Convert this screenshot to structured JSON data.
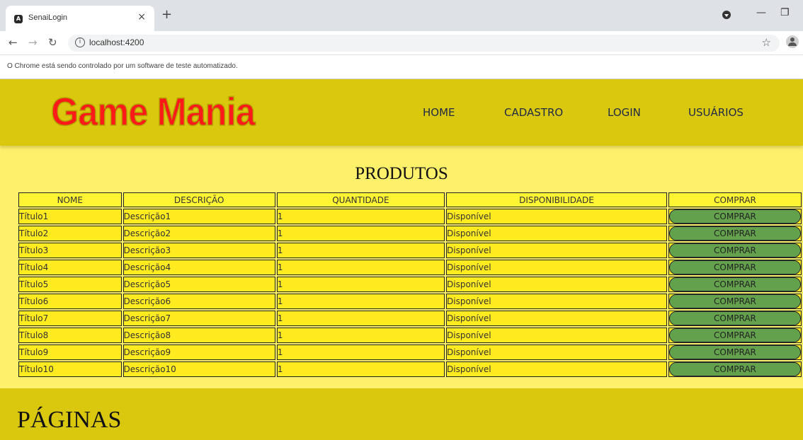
{
  "browser": {
    "tab_title": "SenaiLogin",
    "tab_favicon": "A",
    "tab_close": "×",
    "new_tab": "+",
    "url": "localhost:4200",
    "info_icon": "i",
    "infobar_text": "O Chrome está sendo controlado por um software de teste automatizado."
  },
  "site": {
    "logo": "Game Mania",
    "nav": [
      "HOME",
      "CADASTRO",
      "LOGIN",
      "USUÁRIOS"
    ],
    "section_title": "PRODUTOS",
    "table": {
      "headers": [
        "NOME",
        "DESCRIÇÃO",
        "QUANTIDADE",
        "DISPONIBILIDADE",
        "COMPRAR"
      ],
      "rows": [
        {
          "nome": "Título1",
          "descricao": "Descrição1",
          "quantidade": "1",
          "disponibilidade": "Disponível",
          "button": "COMPRAR"
        },
        {
          "nome": "Título2",
          "descricao": "Descrição2",
          "quantidade": "1",
          "disponibilidade": "Disponível",
          "button": "COMPRAR"
        },
        {
          "nome": "Título3",
          "descricao": "Descrição3",
          "quantidade": "1",
          "disponibilidade": "Disponível",
          "button": "COMPRAR"
        },
        {
          "nome": "Título4",
          "descricao": "Descrição4",
          "quantidade": "1",
          "disponibilidade": "Disponível",
          "button": "COMPRAR"
        },
        {
          "nome": "Título5",
          "descricao": "Descrição5",
          "quantidade": "1",
          "disponibilidade": "Disponível",
          "button": "COMPRAR"
        },
        {
          "nome": "Título6",
          "descricao": "Descrição6",
          "quantidade": "1",
          "disponibilidade": "Disponível",
          "button": "COMPRAR"
        },
        {
          "nome": "Título7",
          "descricao": "Descrição7",
          "quantidade": "1",
          "disponibilidade": "Disponível",
          "button": "COMPRAR"
        },
        {
          "nome": "Título8",
          "descricao": "Descrição8",
          "quantidade": "1",
          "disponibilidade": "Disponível",
          "button": "COMPRAR"
        },
        {
          "nome": "Título9",
          "descricao": "Descrição9",
          "quantidade": "1",
          "disponibilidade": "Disponível",
          "button": "COMPRAR"
        },
        {
          "nome": "Título10",
          "descricao": "Descrição10",
          "quantidade": "1",
          "disponibilidade": "Disponível",
          "button": "COMPRAR"
        }
      ]
    },
    "pages_title": "PÁGINAS"
  },
  "colors": {
    "header_bg": "#dac80f",
    "page_bg": "#fdf06a",
    "cell_bg": "#ffeb1f",
    "button_bg": "#63a14d",
    "logo_red": "#ff1a1a"
  },
  "icons": [
    "back-icon",
    "forward-icon",
    "reload-icon",
    "info-icon",
    "star-icon",
    "account-icon",
    "profile-icon",
    "minimize-icon",
    "restore-icon"
  ]
}
